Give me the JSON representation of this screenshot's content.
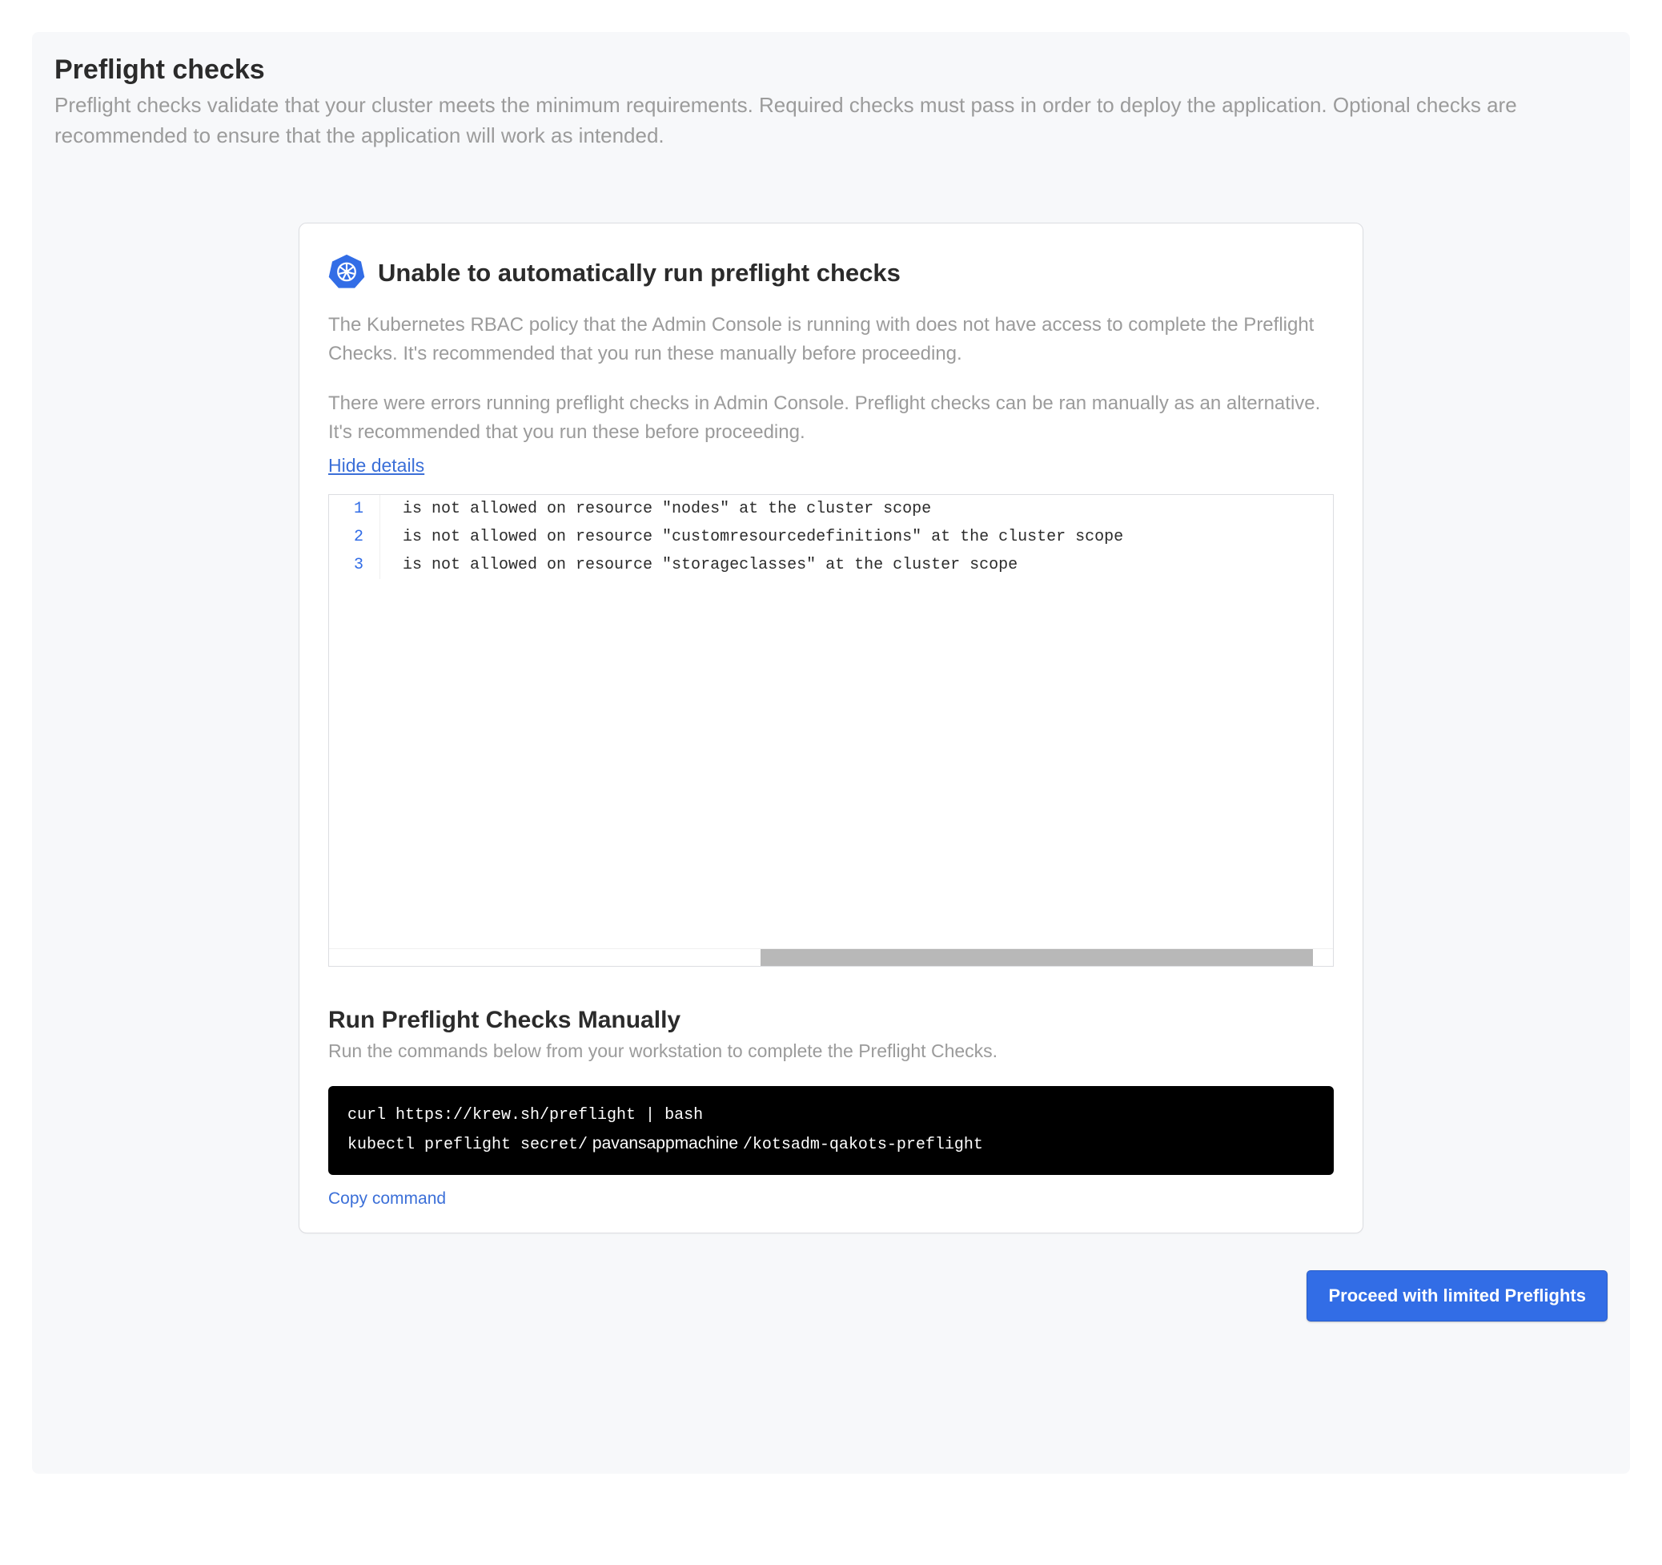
{
  "header": {
    "title": "Preflight checks",
    "description": "Preflight checks validate that your cluster meets the minimum requirements. Required checks must pass in order to deploy the application. Optional checks are recommended to ensure that the application will work as intended."
  },
  "warning": {
    "title": "Unable to automatically run preflight checks",
    "rbac_text": "The Kubernetes RBAC policy that the Admin Console is running with does not have access to complete the Preflight Checks. It's recommended that you run these manually before proceeding.",
    "error_text": "There were errors running preflight checks in Admin Console. Preflight checks can be ran manually as an alternative. It's recommended that you run these before proceeding.",
    "hide_details_label": "Hide details",
    "errors": [
      " is not allowed on resource \"nodes\" at the cluster scope",
      " is not allowed on resource \"customresourcedefinitions\" at the cluster scope",
      " is not allowed on resource \"storageclasses\" at the cluster scope"
    ]
  },
  "manual": {
    "title": "Run Preflight Checks Manually",
    "description": "Run the commands below from your workstation to complete the Preflight Checks.",
    "command_line1": "curl https://krew.sh/preflight | bash",
    "command_line2_pre": "kubectl preflight secret/",
    "command_line2_mid": " pavansappmachine ",
    "command_line2_post": "/kotsadm-qakots-preflight",
    "copy_label": "Copy command"
  },
  "actions": {
    "proceed_label": "Proceed with limited Preflights"
  }
}
